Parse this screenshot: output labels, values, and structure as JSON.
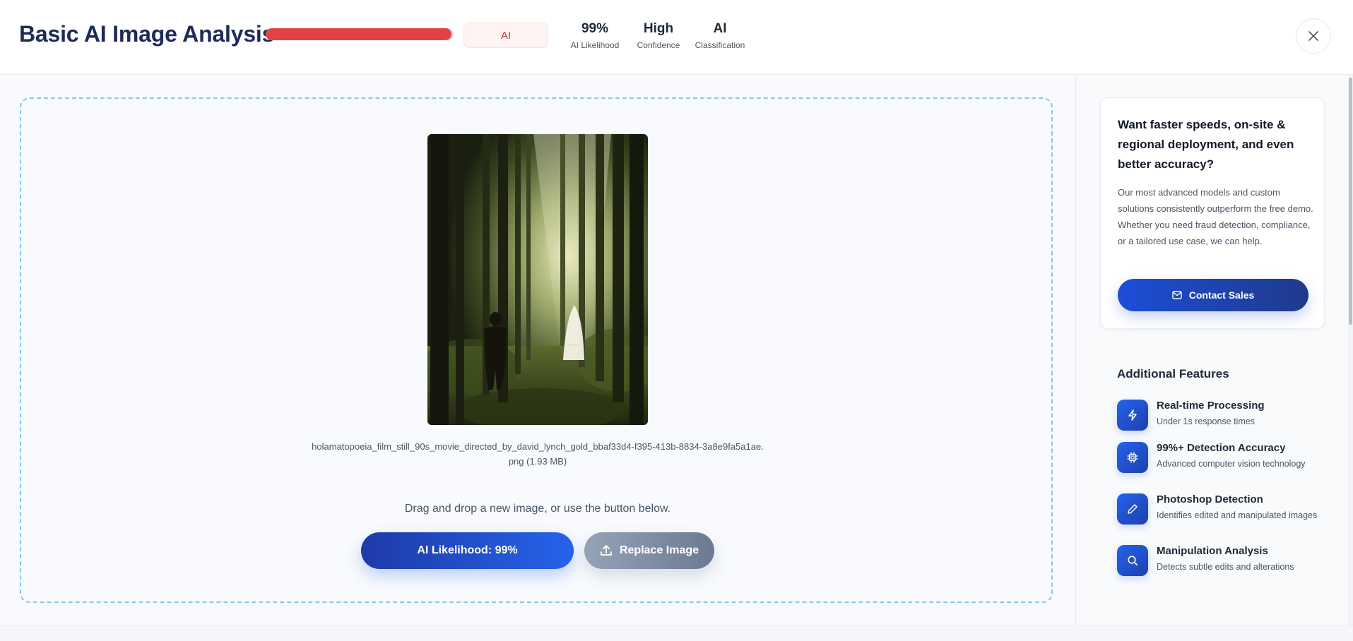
{
  "header": {
    "title": "Basic AI Image Analysis",
    "likelihood_fraction": 0.99,
    "classification_badge": "AI",
    "stats": [
      {
        "value": "99%",
        "label": "AI Likelihood"
      },
      {
        "value": "High",
        "label": "Confidence"
      },
      {
        "value": "AI",
        "label": "Classification"
      }
    ],
    "close_icon": "close-icon"
  },
  "upload": {
    "filename": "holamatopoeia_film_still_90s_movie_directed_by_david_lynch_gold_bbaf33d4-f395-413b-8834-3a8e9fa5a1ae.",
    "filesize": "png (1.93 MB)",
    "drag_hint": "Drag and drop a new image, or use the button below.",
    "likelihood_button": "AI Likelihood: 99%",
    "replace_button": "Replace Image",
    "replace_icon": "upload-icon"
  },
  "promo": {
    "title": "Want faster speeds, on-site & regional deployment, and even better accuracy?",
    "body": "Our most advanced models and custom solutions consistently outperform the free demo. Whether you need fraud detection, compliance, or a tailored use case, we can help.",
    "cta": "Contact Sales",
    "cta_icon": "mail-icon"
  },
  "features": {
    "title": "Additional Features",
    "items": [
      {
        "icon": "lightning-icon",
        "name": "Real-time Processing",
        "desc": "Under 1s response times"
      },
      {
        "icon": "chip-icon",
        "name": "99%+ Detection Accuracy",
        "desc": "Advanced computer vision technology"
      },
      {
        "icon": "pencil-icon",
        "name": "Photoshop Detection",
        "desc": "Identifies edited and manipulated images"
      },
      {
        "icon": "search-icon",
        "name": "Manipulation Analysis",
        "desc": "Detects subtle edits and alterations"
      }
    ]
  },
  "colors": {
    "accent": "#2563eb",
    "danger": "#e04343",
    "title": "#1e2a5a"
  }
}
